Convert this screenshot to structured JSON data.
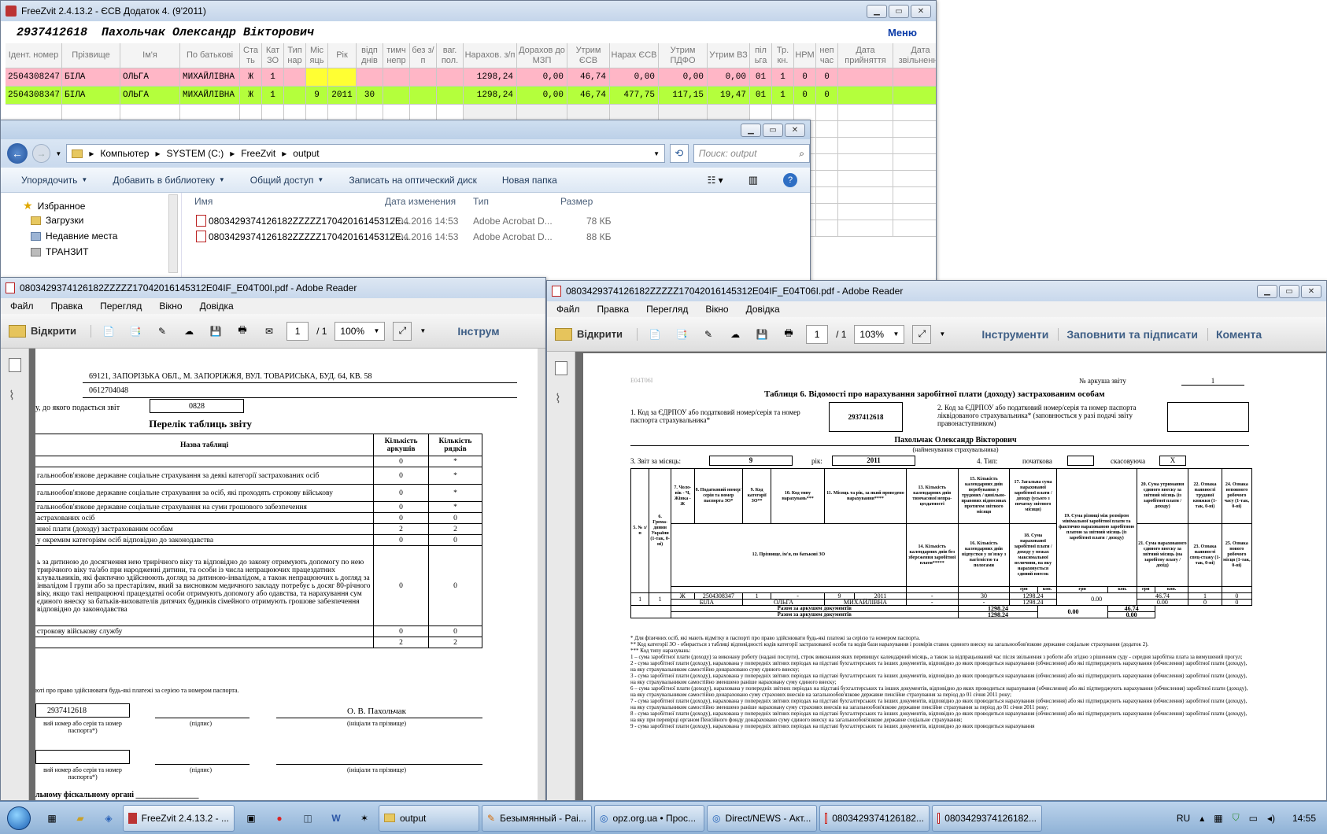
{
  "freezvit": {
    "title": "FreeZvit 2.4.13.2 - ЄСВ Додаток 4. (9'2011)",
    "id": "2937412618",
    "person": "Пахольчак Олександр Вікторович",
    "menu": "Меню",
    "headers": [
      "Ідент. номер",
      "Прізвище",
      "Ім'я",
      "По батькові",
      "Ста ть",
      "Кат ЗО",
      "Тип нар",
      "Міс яць",
      "Рік",
      "відп днів",
      "тимч непр",
      "без з/п",
      "ваг. пол.",
      "Нарахов. з/п",
      "Дорахов до МЗП",
      "Утрим ЄСВ",
      "Нарах ЄСВ",
      "Утрим ПДФО",
      "Утрим ВЗ",
      "пiл ьга",
      "Тр. кн.",
      "НРМ",
      "неп час",
      "Дата прийняття",
      "Дата звільнення",
      "x"
    ],
    "rows": [
      [
        "2504308247",
        "БІЛА",
        "ОЛЬГА",
        "МИХАЙЛІВНА",
        "Ж",
        "1",
        "",
        "",
        "",
        "",
        "",
        "",
        "",
        "1298,24",
        "0,00",
        "46,74",
        "0,00",
        "0,00",
        "0,00",
        "01",
        "1",
        "0",
        "0",
        "",
        ""
      ],
      [
        "2504308347",
        "БІЛА",
        "ОЛЬГА",
        "МИХАЙЛІВНА",
        "Ж",
        "1",
        "",
        "9",
        "2011",
        "30",
        "",
        "",
        "",
        "1298,24",
        "0,00",
        "46,74",
        "477,75",
        "117,15",
        "19,47",
        "01",
        "1",
        "0",
        "0",
        "",
        ""
      ]
    ],
    "close_glyph": "x"
  },
  "explorer": {
    "path": [
      "Компьютер",
      "SYSTEM (C:)",
      "FreeZvit",
      "output"
    ],
    "search_placeholder": "Поиск: output",
    "toolbar": [
      "Упорядочить",
      "Добавить в библиотеку",
      "Общий доступ",
      "Записать на оптический диск",
      "Новая папка"
    ],
    "nav": [
      "Избранное",
      "Загрузки",
      "Недавние места",
      "ТРАНЗИТ"
    ],
    "columns": [
      "Имя",
      "Дата изменения",
      "Тип",
      "Размер"
    ],
    "files": [
      {
        "name": "0803429374126182ZZZZZ17042016145312E...",
        "date": "17.04.2016 14:53",
        "type": "Adobe Acrobat D...",
        "size": "78 КБ"
      },
      {
        "name": "0803429374126182ZZZZZ17042016145312E...",
        "date": "17.04.2016 14:53",
        "type": "Adobe Acrobat D...",
        "size": "88 КБ"
      }
    ]
  },
  "reader1": {
    "title": "0803429374126182ZZZZZ17042016145312E04IF_E04T00I.pdf - Adobe Reader",
    "menu": [
      "Файл",
      "Правка",
      "Перегляд",
      "Вікно",
      "Довідка"
    ],
    "open": "Відкрити",
    "page": "1",
    "pages": "/ 1",
    "zoom": "100%",
    "tools": "Інструм",
    "doc": {
      "address": "69121, ЗАПОРІЗЬКА ОБЛ., М. ЗАПОРІЖЖЯ, ВУЛ. ТОВАРИСЬКА, БУД. 64, КВ. 58",
      "phone": "0612704048",
      "office_label": "у, до якого подається звіт",
      "office_code": "0828",
      "heading": "Перелік таблиць звіту",
      "col_name": "Назва таблиці",
      "col_sheets": "Кількість аркушів",
      "col_rows": "Кількість рядків",
      "rows": [
        {
          "t": "",
          "a": "0",
          "r": "*"
        },
        {
          "t": "гальнообов'язкове державне соціальне страхування за деякі категорії застрахованих осіб",
          "a": "0",
          "r": "*"
        },
        {
          "t": "гальнообов'язкове державне соціальне страхування за осіб, які проходять строкову військову",
          "a": "0",
          "r": "*"
        },
        {
          "t": "гальнообов'язкове державне соціальне страхування на суми грошового забезпечення",
          "a": "0",
          "r": "*"
        },
        {
          "t": "астрахованих осіб",
          "a": "0",
          "r": "0"
        },
        {
          "t": "нної плати (доходу) застрахованим особам",
          "a": "2",
          "r": "2"
        },
        {
          "t": "у окремим категоріям осіб відповідно до законодавства",
          "a": "0",
          "r": "0"
        },
        {
          "t": "ь за дитиною до досягнення нею трирічного віку та відповідно до закону отримують допомогу по нею трирічного віку та/або при народженні дитини, та особи із числа непрацюючих працездатних клувальників, які фактично здійснюють догляд за дитиною-інвалідом, а також непрацюючих ь догляд за інвалідом I групи або за престарілим, який за висновком медичного закладу потребує ь досяг 80-річного віку, якщо такі непрацюючі працездатні особи отримують допомогу або одавства, та нарахування сум єдиного внеску за батьків-вихователів дитячих будинків сімейного отримують грошове забезпечення відповідно до законодавства",
          "a": "0",
          "r": "0"
        },
        {
          "t": "строкову військову службу",
          "a": "0",
          "r": "0"
        },
        {
          "t": "",
          "a": "2",
          "r": "2"
        }
      ],
      "passport_note": "юті про право здійснювати будь-які платежі за серією та номером паспорта.",
      "id_value": "2937412618",
      "signer": "О. В. Пахольчак",
      "id_caption": "вий номер або серія та номер паспорта*)",
      "sign_caption": "(підпис)",
      "name_caption": "(ініціали та прізвище)",
      "fiscal1": "льному фіскальному органі",
      "fiscal2": "льному органі"
    }
  },
  "reader2": {
    "title": "0803429374126182ZZZZZ17042016145312E04IF_E04T06I.pdf - Adobe Reader",
    "menu": [
      "Файл",
      "Правка",
      "Перегляд",
      "Вікно",
      "Довідка"
    ],
    "open": "Відкрити",
    "page": "1",
    "pages": "/ 1",
    "zoom": "103%",
    "tools": "Інструменти",
    "fill": "Заповнити та підписати",
    "comment": "Комента",
    "doc": {
      "code": "E04T06I",
      "sheet_label": "№ аркуша звіту",
      "sheet_no": "1",
      "title": "Таблиця 6. Відомості про нарахування заробітної плати (доходу) застрахованим особам",
      "edrpou_label": "1. Код за ЄДРПОУ або податковий номер/серія та номер паспорта страхувальника*",
      "edrpou": "2937412618",
      "liq_label": "2. Код за ЄДРПОУ або податковий номер/серія та номер паспорта ліквідованого страхувальника* (заповнюється у разі подачі звіту правонаступником)",
      "insurer": "Пахольчак Олександр Вікторович",
      "insurer_caption": "(найменування страхувальника)",
      "month_label": "3. Звіт за місяць:",
      "month": "9",
      "year_label": "рік:",
      "year": "2011",
      "type_label": "4. Тип:",
      "initial": "початкова",
      "cancel": "скасовуюча",
      "cancel_mark": "X",
      "h5": "5. № з/п",
      "h6": "6. Грома-дянин України (1-так, 0-ні)",
      "h7": "7. Чоло-вік - Ч, Жінка - Ж",
      "h8": "8. Податковий номер/ серія та номер паспорта ЗО*",
      "h9": "9. Код категорії ЗО**",
      "h10": "10. Код типу нарахувань***",
      "h11": "11. Місяць та рік, за який проведено нарахування****",
      "h12": "12. Прізвище, ім'я, по батькові ЗО",
      "h13": "13. Кількість календарних днів тимчасової непра-цездатності",
      "h14": "14. Кількість календарних днів без збереження заробітної плати*****",
      "h15": "15. Кількість календарних днів перебування у трудових / цивільно-правових відносинах протягом звітного місяця",
      "h16": "16. Кількість календарних днів відпустки у зв'язку з вагітністю та пологами",
      "h17": "17. Загальна сума нарахованої заробітної плати / доходу (усього з початку звітного місяця)",
      "h18": "18. Сума нарахованої заробітної плати / доходу у межах максимальної величини, на яку нараховується єдиний внесок",
      "h19": "19. Сума різниці між розміром мінімальної заробітної плати та фактично нарахованою заробітною платою за звітний місяць (із заробітної плати / доходу)",
      "h20": "20. Сума утримання єдиного внеску за звітний місяць (із заробітної плати / доходу)",
      "h21": "21. Сума нарахованого єдиного внеску за звітний місяць (на заробітну плату / дохід)",
      "h22": "22. Ознака наявності трудової книжки (1-так, 0-ні)",
      "h23": "23. Ознака наявності спец-стажу (1-так, 0-ні)",
      "h24": "24. Ознака неповного робочого часу (1-так, 0-ні)",
      "h25": "25. Ознака нового робочого місця (1-так, 0-ні)",
      "grn": "грн",
      "kop": "коп.",
      "r_no": "1",
      "r_cit": "1",
      "r_sex": "Ж",
      "r_id": "2504308347",
      "r_cat": "1",
      "r_type": "-",
      "r_month": "9",
      "r_year": "2011",
      "r_13": "-",
      "r_14": "-",
      "r_15": "30",
      "r_16": "-",
      "r_17": "1298.24",
      "r_18": "1298.24",
      "r_19": "0.00",
      "r_20": "46.74",
      "r_21": "0.00",
      "r_22": "1",
      "r_23": "0",
      "r_24": "0",
      "r_25": "0",
      "r_surname": "БІЛА",
      "r_name": "ОЛЬГА",
      "r_patronymic": "МИХАЙЛІВНА",
      "total1": "Разом за аркушем документів",
      "total2": "Разом за аркушем документів",
      "t17": "1298.24",
      "t18": "1298.24",
      "t19": "0.00",
      "t20": "46.74",
      "t21": "0.00",
      "footnotes": [
        "* Для фізичних осіб, які мають відмітку в паспорті про право здійснювати будь-які платежі за серією та номером паспорта.",
        "** Код категорії ЗО - обирається з таблиці відповідності кодів категорії застрахованої особи та кодів бази нарахування і розмірів ставок єдиного внеску на загальнообов'язкове державне соціальне страхування (додаток 2).",
        "*** Код типу нарахувань:",
        "1 – сума заробітної плати (доходу) за виконану роботу (надані послуги), строк виконання яких перевищує календарний місяць, а також за відпрацьований час після звільнення з роботи або згідно з рішенням суду - середня заробітна плата за вимушений прогул;",
        "2 - сума заробітної плати (доходу), нарахована у попередніх звітних періодах на підставі бухгалтерських та інших документів, відповідно до яких проводиться нарахування (обчислення) або які підтверджують нарахування (обчислення) заробітної плати (доходу), на яку страхувальником самостійно донараховано суму єдиного внеску;",
        "3 - сума заробітної плати (доходу), нарахована у попередніх звітних періодах на підставі бухгалтерських та інших документів, відповідно до яких проводиться нарахування (обчислення) або які підтверджують нарахування (обчислення) заробітної плати (доходу), на яку страхувальником самостійно зменшено раніше нараховану суму єдиного внеску;",
        "6 – сума заробітної плати (доходу), нарахована у попередніх звітних періодах на підставі бухгалтерських та інших документів, відповідно до яких проводиться нарахування (обчислення) або які підтверджують нарахування (обчислення) заробітної плати (доходу), на яку страхувальником самостійно донараховано суму страхових внесків на загальнообов'язкове державне пенсійне страхування за період до 01 січня 2011 року;",
        "7 - сума заробітної плати (доходу), нарахована у попередніх звітних періодах на підставі бухгалтерських та інших документів, відповідно до яких проводиться нарахування (обчислення) або які підтверджують нарахування (обчислення) заробітної плати (доходу), на яку страхувальником самостійно зменшено раніше нараховану суму страхових внесків на загальнообов'язкове державне пенсійне страхування за період до 01 січня 2011 року;",
        "8 - сума заробітної плати (доходу), нарахована у попередніх звітних періодах на підставі бухгалтерських та інших документів, відповідно до яких проводиться нарахування (обчислення) або які підтверджують нарахування (обчислення) заробітної плати (доходу), на яку при перевірці органом Пенсійного фонду донараховано суму єдиного внеску на загальнообов'язкове державне соціальне страхування;",
        "9 - сума заробітної плати (доходу), нарахована у попередніх звітних періодах на підставі бухгалтерських та інших документів, відповідно до яких проводиться нарахування"
      ]
    }
  },
  "taskbar": {
    "items": [
      "FreeZvit 2.4.13.2 - ...",
      "output",
      "Безымянный - Pai...",
      "opz.org.ua • Прос...",
      "Direct/NEWS - Акт...",
      "0803429374126182...",
      "0803429374126182..."
    ],
    "lang": "RU",
    "time": "14:55"
  }
}
